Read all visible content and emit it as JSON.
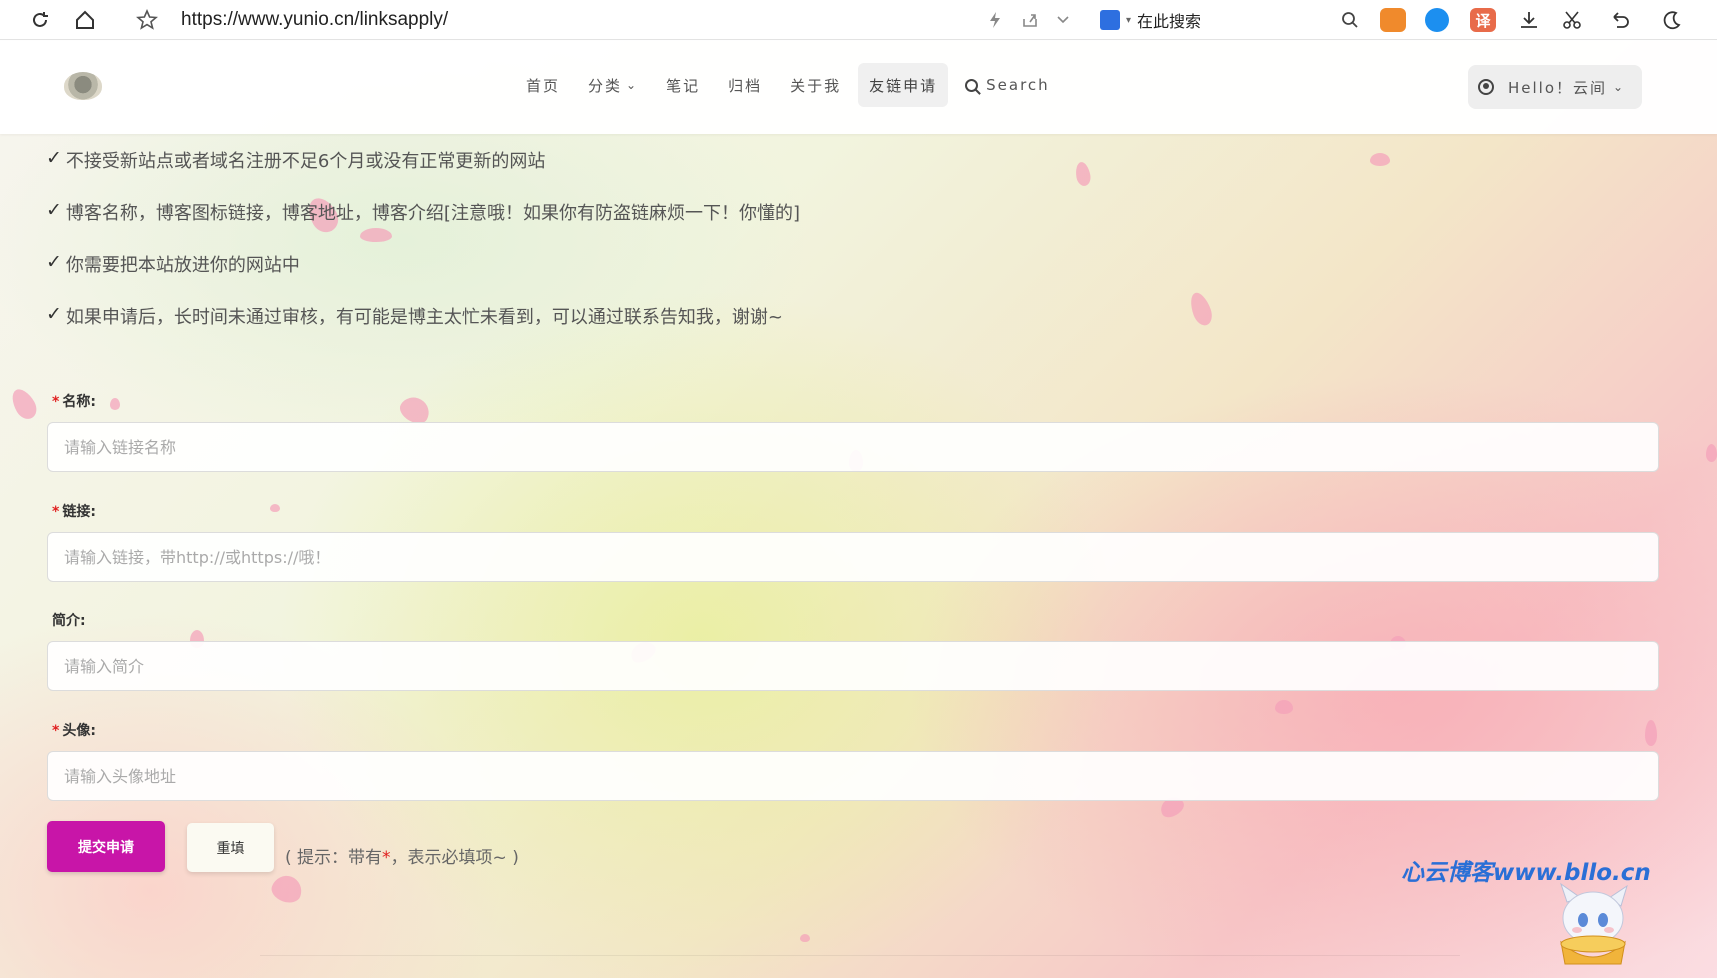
{
  "browser": {
    "url": "https://www.yunio.cn/linksapply/",
    "search_placeholder": "在此搜索",
    "ext_translate": "译"
  },
  "nav": {
    "items": [
      {
        "label": "首页"
      },
      {
        "label": "分类"
      },
      {
        "label": "笔记"
      },
      {
        "label": "归档"
      },
      {
        "label": "关于我"
      },
      {
        "label": "友链申请"
      }
    ],
    "search_label": "Search",
    "user_label": "Hello！云间"
  },
  "rules": [
    "不接受新站点或者域名注册不足6个月或没有正常更新的网站",
    "博客名称，博客图标链接，博客地址，博客介绍[注意哦！如果你有防盗链麻烦一下！你懂的]",
    "你需要把本站放进你的网站中",
    "如果申请后，长时间未通过审核，有可能是博主太忙未看到，可以通过联系告知我，谢谢~"
  ],
  "form": {
    "name": {
      "label": "名称:",
      "placeholder": "请输入链接名称"
    },
    "link": {
      "label": "链接:",
      "placeholder": "请输入链接，带http://或https://哦！"
    },
    "intro": {
      "label": "简介:",
      "placeholder": "请输入简介"
    },
    "avatar": {
      "label": "头像:",
      "placeholder": "请输入头像地址"
    },
    "submit_label": "提交申请",
    "reset_label": "重填",
    "hint_prefix": "( 提示：带有",
    "hint_star": "*",
    "hint_suffix": "，表示必填项~ )"
  },
  "watermark": "心云博客www.bllo.cn",
  "colors": {
    "submit": "#c815a8",
    "required": "#e02020",
    "watermark": "#2a6fd6"
  }
}
